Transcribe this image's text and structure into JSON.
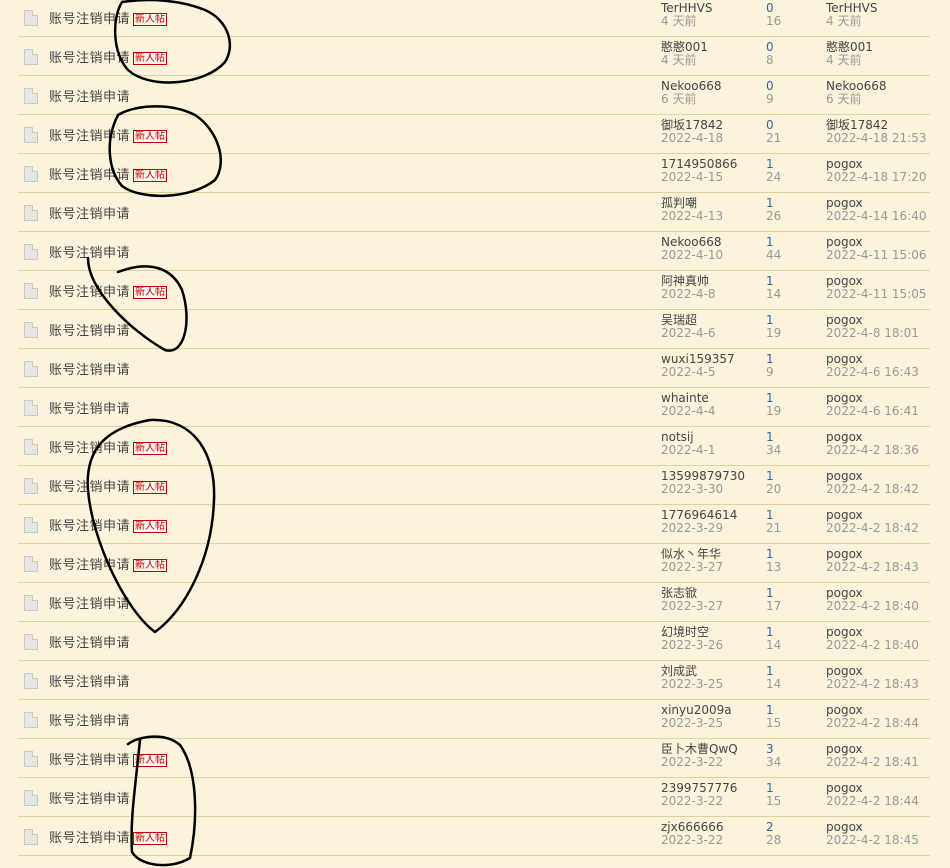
{
  "new_badge_label": "新人帖",
  "threads": [
    {
      "title": "账号注销申请",
      "is_new": true,
      "author": "TerHHVS",
      "date": "4 天前",
      "replies": "0",
      "views": "16",
      "last_poster": "TerHHVS",
      "last_time": "4 天前"
    },
    {
      "title": "账号注销申请",
      "is_new": true,
      "author": "憨憨001",
      "date": "4 天前",
      "replies": "0",
      "views": "8",
      "last_poster": "憨憨001",
      "last_time": "4 天前"
    },
    {
      "title": "账号注销申请",
      "is_new": false,
      "author": "Nekoo668",
      "date": "6 天前",
      "replies": "0",
      "views": "9",
      "last_poster": "Nekoo668",
      "last_time": "6 天前"
    },
    {
      "title": "账号注销申请",
      "is_new": true,
      "author": "御坂17842",
      "date": "2022-4-18",
      "replies": "0",
      "views": "21",
      "last_poster": "御坂17842",
      "last_time": "2022-4-18 21:53"
    },
    {
      "title": "账号注销申请",
      "is_new": true,
      "author": "1714950866",
      "date": "2022-4-15",
      "replies": "1",
      "views": "24",
      "last_poster": "pogox",
      "last_time": "2022-4-18 17:20"
    },
    {
      "title": "账号注销申请",
      "is_new": false,
      "author": "孤判嘲",
      "date": "2022-4-13",
      "replies": "1",
      "views": "26",
      "last_poster": "pogox",
      "last_time": "2022-4-14 16:40"
    },
    {
      "title": "账号注销申请",
      "is_new": false,
      "author": "Nekoo668",
      "date": "2022-4-10",
      "replies": "1",
      "views": "44",
      "last_poster": "pogox",
      "last_time": "2022-4-11 15:06"
    },
    {
      "title": "账号注销申请",
      "is_new": true,
      "author": "阿神真帅",
      "date": "2022-4-8",
      "replies": "1",
      "views": "14",
      "last_poster": "pogox",
      "last_time": "2022-4-11 15:05"
    },
    {
      "title": "账号注销申请",
      "is_new": false,
      "author": "吴瑞超",
      "date": "2022-4-6",
      "replies": "1",
      "views": "19",
      "last_poster": "pogox",
      "last_time": "2022-4-8 18:01"
    },
    {
      "title": "账号注销申请",
      "is_new": false,
      "author": "wuxi159357",
      "date": "2022-4-5",
      "replies": "1",
      "views": "9",
      "last_poster": "pogox",
      "last_time": "2022-4-6 16:43"
    },
    {
      "title": "账号注销申请",
      "is_new": false,
      "author": "whainte",
      "date": "2022-4-4",
      "replies": "1",
      "views": "19",
      "last_poster": "pogox",
      "last_time": "2022-4-6 16:41"
    },
    {
      "title": "账号注销申请",
      "is_new": true,
      "author": "notsij",
      "date": "2022-4-1",
      "replies": "1",
      "views": "34",
      "last_poster": "pogox",
      "last_time": "2022-4-2 18:36"
    },
    {
      "title": "账号注销申请",
      "is_new": true,
      "author": "13599879730",
      "date": "2022-3-30",
      "replies": "1",
      "views": "20",
      "last_poster": "pogox",
      "last_time": "2022-4-2 18:42"
    },
    {
      "title": "账号注销申请",
      "is_new": true,
      "author": "1776964614",
      "date": "2022-3-29",
      "replies": "1",
      "views": "21",
      "last_poster": "pogox",
      "last_time": "2022-4-2 18:42"
    },
    {
      "title": "账号注销申请",
      "is_new": true,
      "author": "似水丶年华",
      "date": "2022-3-27",
      "replies": "1",
      "views": "13",
      "last_poster": "pogox",
      "last_time": "2022-4-2 18:43"
    },
    {
      "title": "账号注销申请",
      "is_new": false,
      "author": "张志锨",
      "date": "2022-3-27",
      "replies": "1",
      "views": "17",
      "last_poster": "pogox",
      "last_time": "2022-4-2 18:40"
    },
    {
      "title": "账号注销申请",
      "is_new": false,
      "author": "幻境时空",
      "date": "2022-3-26",
      "replies": "1",
      "views": "14",
      "last_poster": "pogox",
      "last_time": "2022-4-2 18:40"
    },
    {
      "title": "账号注销申请",
      "is_new": false,
      "author": "刘成武",
      "date": "2022-3-25",
      "replies": "1",
      "views": "14",
      "last_poster": "pogox",
      "last_time": "2022-4-2 18:43"
    },
    {
      "title": "账号注销申请",
      "is_new": false,
      "author": "xinyu2009a",
      "date": "2022-3-25",
      "replies": "1",
      "views": "15",
      "last_poster": "pogox",
      "last_time": "2022-4-2 18:44"
    },
    {
      "title": "账号注销申请",
      "is_new": true,
      "author": "臣卜木曹QwQ",
      "date": "2022-3-22",
      "replies": "3",
      "views": "34",
      "last_poster": "pogox",
      "last_time": "2022-4-2 18:41"
    },
    {
      "title": "账号注销申请",
      "is_new": false,
      "author": "2399757776",
      "date": "2022-3-22",
      "replies": "1",
      "views": "15",
      "last_poster": "pogox",
      "last_time": "2022-4-2 18:44"
    },
    {
      "title": "账号注销申请",
      "is_new": true,
      "author": "zjx666666",
      "date": "2022-3-22",
      "replies": "2",
      "views": "28",
      "last_poster": "pogox",
      "last_time": "2022-4-2 18:45"
    }
  ]
}
